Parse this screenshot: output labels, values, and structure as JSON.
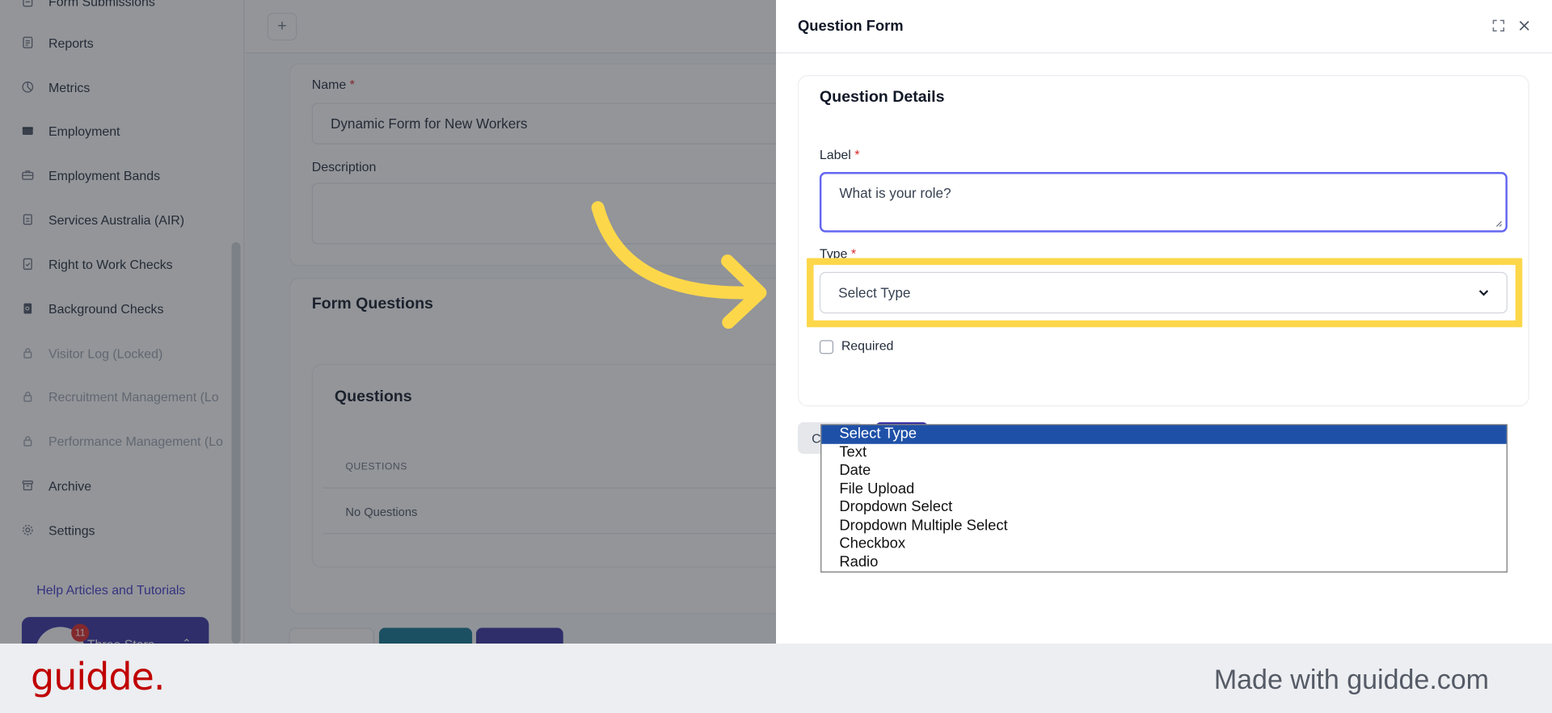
{
  "sidebar": {
    "items": [
      {
        "label": "Form Submissions",
        "icon": "form-icon",
        "locked": false
      },
      {
        "label": "Reports",
        "icon": "document-icon",
        "locked": false
      },
      {
        "label": "Metrics",
        "icon": "pie-chart-icon",
        "locked": false
      },
      {
        "label": "Employment",
        "icon": "wallet-icon",
        "locked": false
      },
      {
        "label": "Employment Bands",
        "icon": "briefcase-icon",
        "locked": false
      },
      {
        "label": "Services Australia (AIR)",
        "icon": "clipboard-icon",
        "locked": false
      },
      {
        "label": "Right to Work Checks",
        "icon": "file-check-icon",
        "locked": false
      },
      {
        "label": "Background Checks",
        "icon": "file-search-icon",
        "locked": false
      },
      {
        "label": "Visitor Log (Locked)",
        "icon": "lock-icon",
        "locked": true
      },
      {
        "label": "Recruitment Management (Lo",
        "icon": "lock-icon",
        "locked": true
      },
      {
        "label": "Performance Management (Lo",
        "icon": "lock-icon",
        "locked": true
      },
      {
        "label": "Archive",
        "icon": "archive-icon",
        "locked": false
      },
      {
        "label": "Settings",
        "icon": "gear-icon",
        "locked": false
      }
    ],
    "help_link": "Help Articles and Tutorials",
    "org": {
      "name": "Three Stars",
      "badge": "11"
    }
  },
  "main": {
    "plus_label": "+",
    "name_label": "Name",
    "name_value": "Dynamic Form for New Workers",
    "description_label": "Description",
    "form_questions_title": "Form Questions",
    "questions_title": "Questions",
    "questions_column": "QUESTIONS",
    "empty_text": "No Questions"
  },
  "drawer": {
    "title": "Question Form",
    "section_title": "Question Details",
    "label_field_label": "Label",
    "label_value": "What is your role?",
    "type_label": "Type",
    "select_value": "Select Type",
    "required_label": "Required",
    "cancel_label": "C",
    "type_options": [
      "Select Type",
      "Text",
      "Date",
      "File Upload",
      "Dropdown Select",
      "Dropdown Multiple Select",
      "Checkbox",
      "Radio"
    ],
    "selected_index": 0
  },
  "colors": {
    "accent": "#3730a3",
    "highlight": "#fdd74a",
    "required": "#dc2626",
    "brand": "#c00000",
    "teal": "#0e7490"
  },
  "footer": {
    "brand": "guidde.",
    "made_with": "Made with guidde.com"
  }
}
